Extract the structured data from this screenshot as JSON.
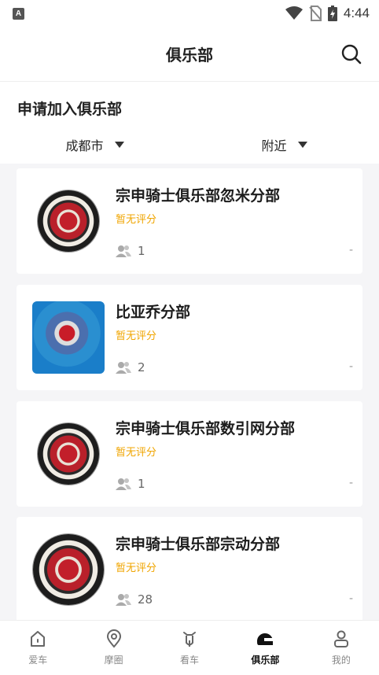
{
  "status_bar": {
    "app_icon": "A",
    "time": "4:44"
  },
  "header": {
    "title": "俱乐部",
    "search_icon": "search-icon"
  },
  "section": {
    "title": "申请加入俱乐部"
  },
  "filters": [
    {
      "label": "成都市"
    },
    {
      "label": "附近"
    }
  ],
  "clubs": [
    {
      "name": "宗申骑士俱乐部忽米分部",
      "rating": "暂无评分",
      "members": "1",
      "dash": "-",
      "thumb": "badge"
    },
    {
      "name": "比亚乔分部",
      "rating": "暂无评分",
      "members": "2",
      "dash": "-",
      "thumb": "photo"
    },
    {
      "name": "宗申骑士俱乐部数引网分部",
      "rating": "暂无评分",
      "members": "1",
      "dash": "-",
      "thumb": "badge"
    },
    {
      "name": "宗申骑士俱乐部宗动分部",
      "rating": "暂无评分",
      "members": "28",
      "dash": "-",
      "thumb": "badge-big"
    }
  ],
  "tabs": [
    {
      "label": "爱车",
      "icon": "home-icon"
    },
    {
      "label": "摩圈",
      "icon": "location-pin-icon"
    },
    {
      "label": "看车",
      "icon": "motorcycle-icon"
    },
    {
      "label": "俱乐部",
      "icon": "helmet-icon",
      "active": true
    },
    {
      "label": "我的",
      "icon": "person-icon"
    }
  ],
  "colors": {
    "rating": "#f0a500",
    "list_bg": "#f5f5f7"
  }
}
